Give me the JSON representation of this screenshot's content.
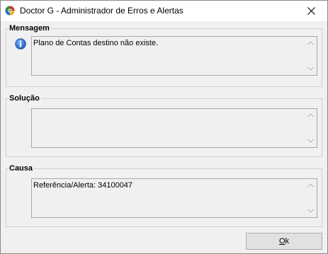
{
  "window": {
    "title": "Doctor G - Administrador de Erros e Alertas"
  },
  "icons": {
    "app": "app-logo-icon",
    "close": "close-icon",
    "info": "info-icon",
    "scroll_up": "chevron-up-icon",
    "scroll_down": "chevron-down-icon"
  },
  "groups": {
    "mensagem": {
      "label": "Mensagem",
      "text": "Plano de Contas destino não existe."
    },
    "solucao": {
      "label": "Solução",
      "text": ""
    },
    "causa": {
      "label": "Causa",
      "text": "Referência/Alerta: 34100047"
    }
  },
  "buttons": {
    "ok_mnemonic": "O",
    "ok_rest": "k"
  },
  "colors": {
    "window_bg": "#f0f0f0",
    "titlebar_bg": "#ffffff",
    "info_blue": "#1f5fbf"
  }
}
